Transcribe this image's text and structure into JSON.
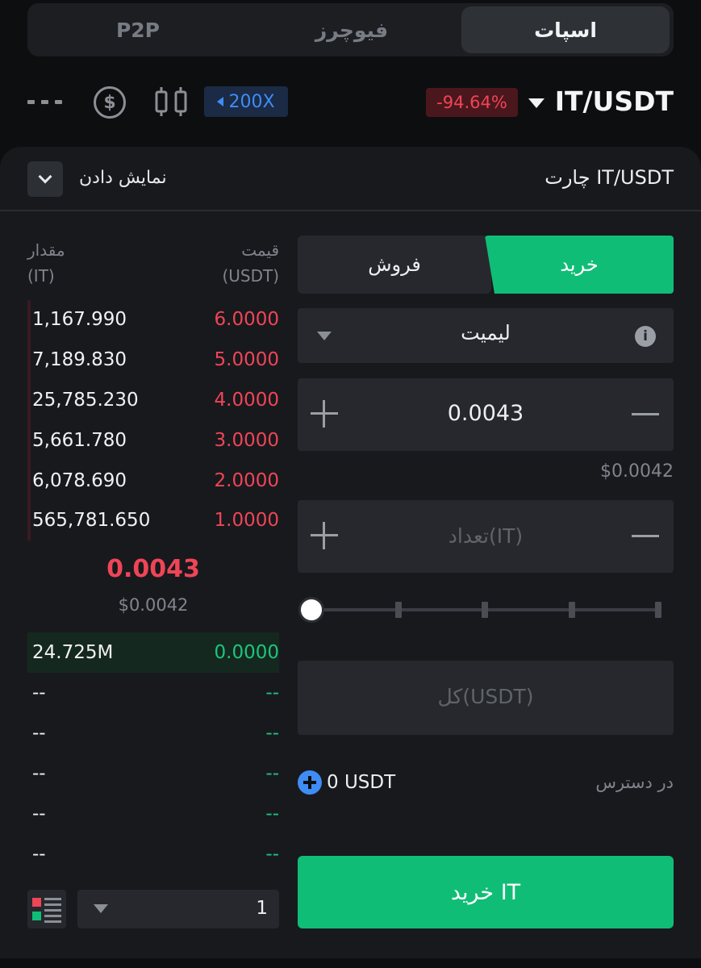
{
  "market_tabs": [
    "P2P",
    "فیوچرز",
    "اسپات"
  ],
  "header": {
    "pair": "IT/USDT",
    "change": "-94.64%",
    "leverage": "200X"
  },
  "chart_row": {
    "chart_label": "چارت IT/USDT",
    "show_label": "نمایش دادن"
  },
  "order_book": {
    "price_header": [
      "قیمت",
      "(USDT)"
    ],
    "amount_header": [
      "مقدار",
      "(IT)"
    ],
    "asks": [
      {
        "price": "6.0000",
        "amount": "1,167.990"
      },
      {
        "price": "5.0000",
        "amount": "7,189.830"
      },
      {
        "price": "4.0000",
        "amount": "25,785.230"
      },
      {
        "price": "3.0000",
        "amount": "5,661.780"
      },
      {
        "price": "2.0000",
        "amount": "6,078.690"
      },
      {
        "price": "1.0000",
        "amount": "565,781.650"
      }
    ],
    "last_price": "0.0043",
    "last_price_usd": "$0.0042",
    "bids": [
      {
        "price": "0.0000",
        "amount": "24.725M"
      },
      {
        "price": "--",
        "amount": "--"
      },
      {
        "price": "--",
        "amount": "--"
      },
      {
        "price": "--",
        "amount": "--"
      },
      {
        "price": "--",
        "amount": "--"
      },
      {
        "price": "--",
        "amount": "--"
      }
    ],
    "depth_value": "1"
  },
  "trade_form": {
    "buy_tab": "خرید",
    "sell_tab": "فروش",
    "order_type": "لیمیت",
    "price_value": "0.0043",
    "price_usd": "$0.0042",
    "quantity_placeholder": "تعداد(IT)",
    "total_placeholder": "کل(USDT)",
    "slider_percent": 0,
    "available_label": "در دسترس",
    "available_value": "0 USDT",
    "submit_label": "خرید IT"
  },
  "colors": {
    "green": "#10bd77",
    "red": "#ef4557",
    "blue": "#3f8cf5"
  },
  "icons": [
    "more-icon",
    "dollar-icon",
    "candlestick-icon",
    "chevron-down-icon",
    "info-icon",
    "plus-icon",
    "minus-icon",
    "depth-layout-icon"
  ]
}
